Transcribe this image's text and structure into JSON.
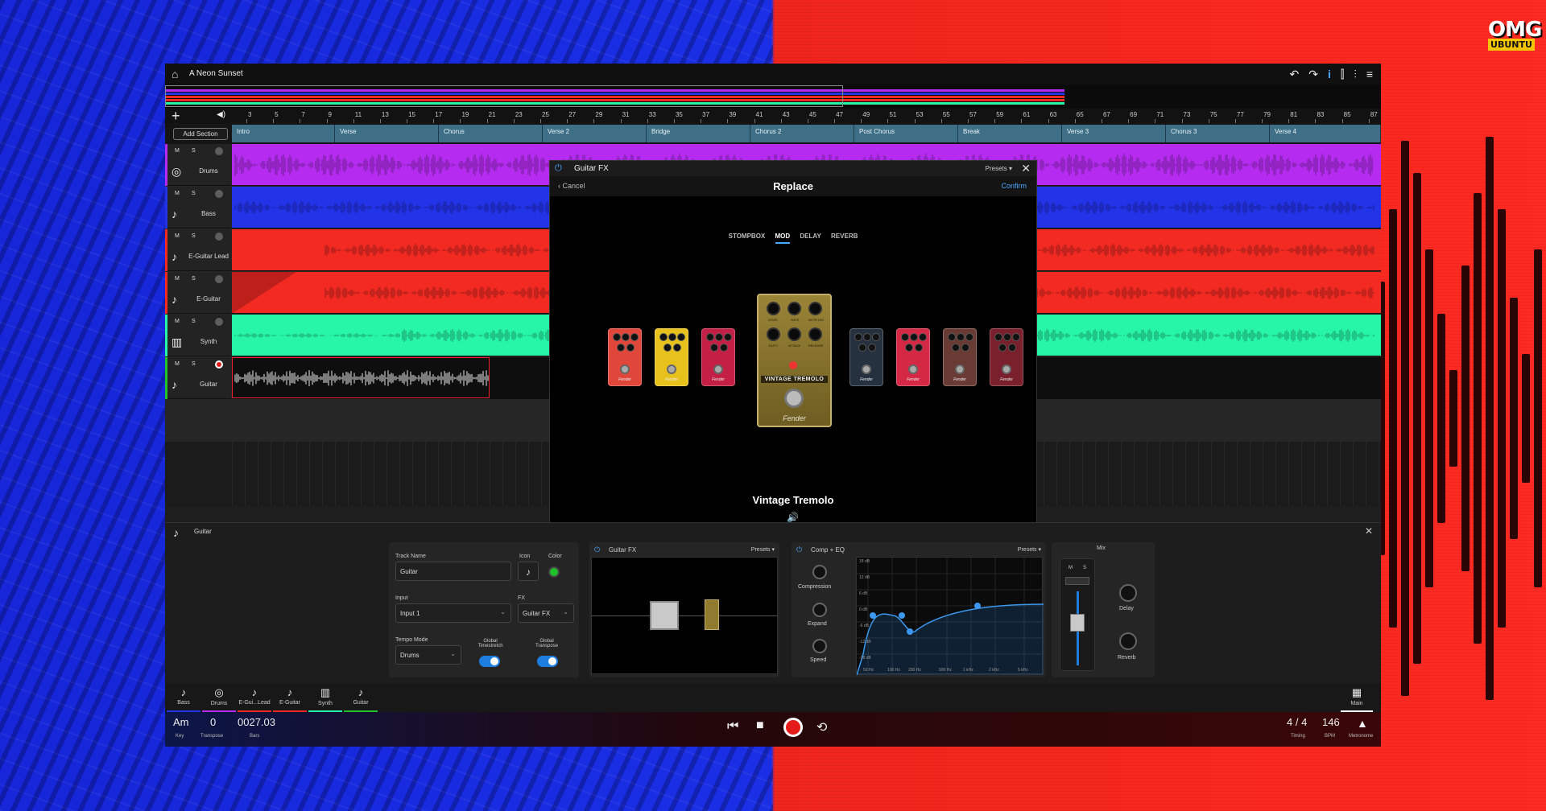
{
  "branding": {
    "line1": "OMG",
    "line2": "UBUNTU"
  },
  "window": {
    "song_title": "A Neon Sunset",
    "home_icon": "home-icon"
  },
  "timeline": {
    "add_label": "+",
    "ruler_numbers": [
      "3",
      "5",
      "7",
      "9",
      "11",
      "13",
      "15",
      "17",
      "19",
      "21",
      "23",
      "25",
      "27",
      "29",
      "31",
      "33",
      "35",
      "37",
      "39",
      "41",
      "43",
      "45",
      "47",
      "49",
      "51",
      "53",
      "55",
      "57",
      "59",
      "61",
      "63",
      "65",
      "67",
      "69",
      "71",
      "73",
      "75",
      "77",
      "79",
      "81",
      "83",
      "85",
      "87"
    ],
    "add_section": "Add Section",
    "sections": [
      "Intro",
      "Verse",
      "Chorus",
      "Verse 2",
      "Bridge",
      "Chorus 2",
      "Post Chorus",
      "Break",
      "Verse 3",
      "Chorus 3",
      "Verse 4"
    ]
  },
  "tracks": [
    {
      "name": "Drums",
      "mute": "M",
      "solo": "S",
      "color": "#b52cf0",
      "icon": "drum-kit-icon"
    },
    {
      "name": "Bass",
      "mute": "M",
      "solo": "S",
      "color": "#2233e8",
      "icon": "guitar-icon"
    },
    {
      "name": "E-Guitar Lead",
      "mute": "M",
      "solo": "S",
      "color": "#f22a22",
      "icon": "guitar-icon"
    },
    {
      "name": "E-Guitar",
      "mute": "M",
      "solo": "S",
      "color": "#f22a22",
      "icon": "guitar-icon"
    },
    {
      "name": "Synth",
      "mute": "M",
      "solo": "S",
      "color": "#27f5a8",
      "icon": "keyboard-icon"
    },
    {
      "name": "Guitar",
      "mute": "M",
      "solo": "S",
      "color": "#0e0e0e",
      "icon": "guitar-icon"
    }
  ],
  "fx_modal": {
    "title": "Guitar FX",
    "presets": "Presets",
    "cancel": "Cancel",
    "heading": "Replace",
    "confirm": "Confirm",
    "tabs": [
      "STOMPBOX",
      "MOD",
      "DELAY",
      "REVERB"
    ],
    "active_tab": "MOD",
    "pedal_title": "VINTAGE TREMOLO",
    "pedal_knobs": [
      "LEVEL",
      "RATE",
      "NOTE DIV",
      "DUTY",
      "ATTACK",
      "RELEASE"
    ],
    "brand": "Fender",
    "selected_name": "Vintage Tremolo"
  },
  "editor": {
    "track": "Guitar",
    "track_name_label": "Track Name",
    "track_name_value": "Guitar",
    "icon_label": "Icon",
    "color_label": "Color",
    "input_label": "Input",
    "input_value": "Input 1",
    "fx_label": "FX",
    "fx_value": "Guitar FX",
    "tempo_mode_label": "Tempo Mode",
    "tempo_mode_value": "Drums",
    "global_timestretch": "Global Timestretch",
    "global_transpose": "Global Transpose",
    "guitar_fx_panel": "Guitar FX",
    "presets": "Presets",
    "comp_eq_panel": "Comp + EQ",
    "compression": "Compression",
    "expand": "Expand",
    "speed": "Speed",
    "eq_db": [
      "18 dB",
      "12 dB",
      "6 dB",
      "0 dB",
      "-6 dB",
      "-12 dB",
      "-18 dB"
    ],
    "eq_hz": [
      "50 Hz",
      "100 Hz",
      "200 Hz",
      "500 Hz",
      "1 kHz",
      "2 kHz",
      "5 kHz"
    ],
    "mix": "Mix",
    "mix_m": "M",
    "mix_s": "S",
    "delay": "Delay",
    "reverb": "Reverb",
    "accent": "#1d7ee0",
    "track_color": "#22c32a"
  },
  "track_strip": [
    {
      "name": "Bass",
      "icon": "guitar-icon",
      "color": "#2233e8"
    },
    {
      "name": "Drums",
      "icon": "drum-kit-icon",
      "color": "#b52cf0"
    },
    {
      "name": "E-Gui...Lead",
      "icon": "guitar-icon",
      "color": "#f22a22"
    },
    {
      "name": "E-Guitar",
      "icon": "guitar-icon",
      "color": "#f22a22"
    },
    {
      "name": "Synth",
      "icon": "keyboard-icon",
      "color": "#27f5a8"
    },
    {
      "name": "Guitar",
      "icon": "guitar-icon",
      "color": "#22c32a"
    }
  ],
  "main_label": "Main",
  "transport": {
    "key": "Am",
    "key_label": "Key",
    "transpose": "0",
    "transpose_label": "Transpose",
    "bars": "0027.03",
    "bars_label": "Bars",
    "timing": "4 / 4",
    "timing_label": "Timing",
    "bpm": "146",
    "bpm_label": "BPM",
    "metronome_label": "Metronome"
  }
}
